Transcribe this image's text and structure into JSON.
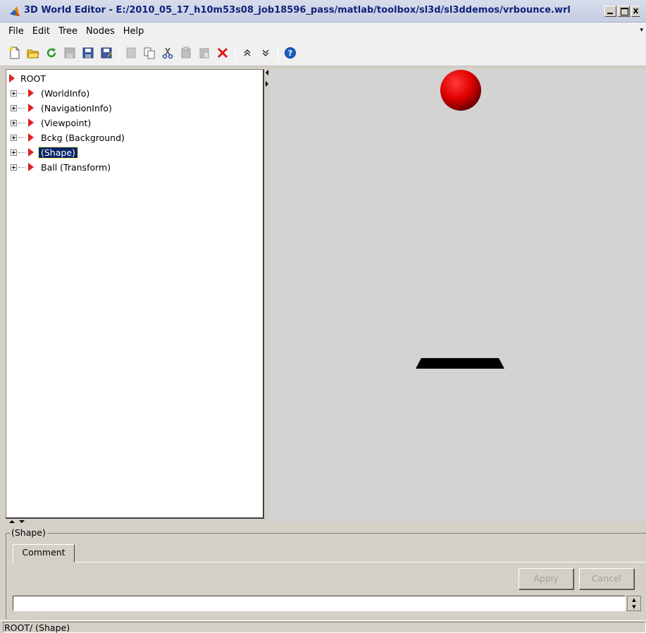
{
  "window": {
    "title": "3D World Editor - E:/2010_05_17_h10m53s08_job18596_pass/matlab/toolbox/sl3d/sl3ddemos/vrbounce.wrl",
    "controls": {
      "minimize": "_",
      "maximize": "□",
      "close": "x"
    }
  },
  "menu": {
    "items": [
      "File",
      "Edit",
      "Tree",
      "Nodes",
      "Help"
    ]
  },
  "toolbar": {
    "icons": [
      "new-icon",
      "open-icon",
      "reload-icon",
      "save-disabled-icon",
      "save-icon",
      "save-as-icon",
      "undo-disabled-icon",
      "copy-icon",
      "cut-icon",
      "paste-disabled-icon",
      "paste-special-disabled-icon",
      "delete-icon",
      "move-up-icon",
      "move-down-icon",
      "help-icon"
    ]
  },
  "tree": {
    "root": "ROOT",
    "nodes": [
      {
        "label": "(WorldInfo)",
        "selected": false
      },
      {
        "label": "(NavigationInfo)",
        "selected": false
      },
      {
        "label": "(Viewpoint)",
        "selected": false
      },
      {
        "label": "Bckg (Background)",
        "selected": false
      },
      {
        "label": "(Shape)",
        "selected": true
      },
      {
        "label": "Ball (Transform)",
        "selected": false
      }
    ]
  },
  "scene": {
    "background_color": "#d3d3d3",
    "ball_color": "#e00000",
    "platform_color": "#000000"
  },
  "properties": {
    "group_title": "(Shape)",
    "tab_label": "Comment",
    "apply_label": "Apply",
    "cancel_label": "Cancel",
    "comment_value": ""
  },
  "status": {
    "path": "ROOT/ (Shape)"
  }
}
